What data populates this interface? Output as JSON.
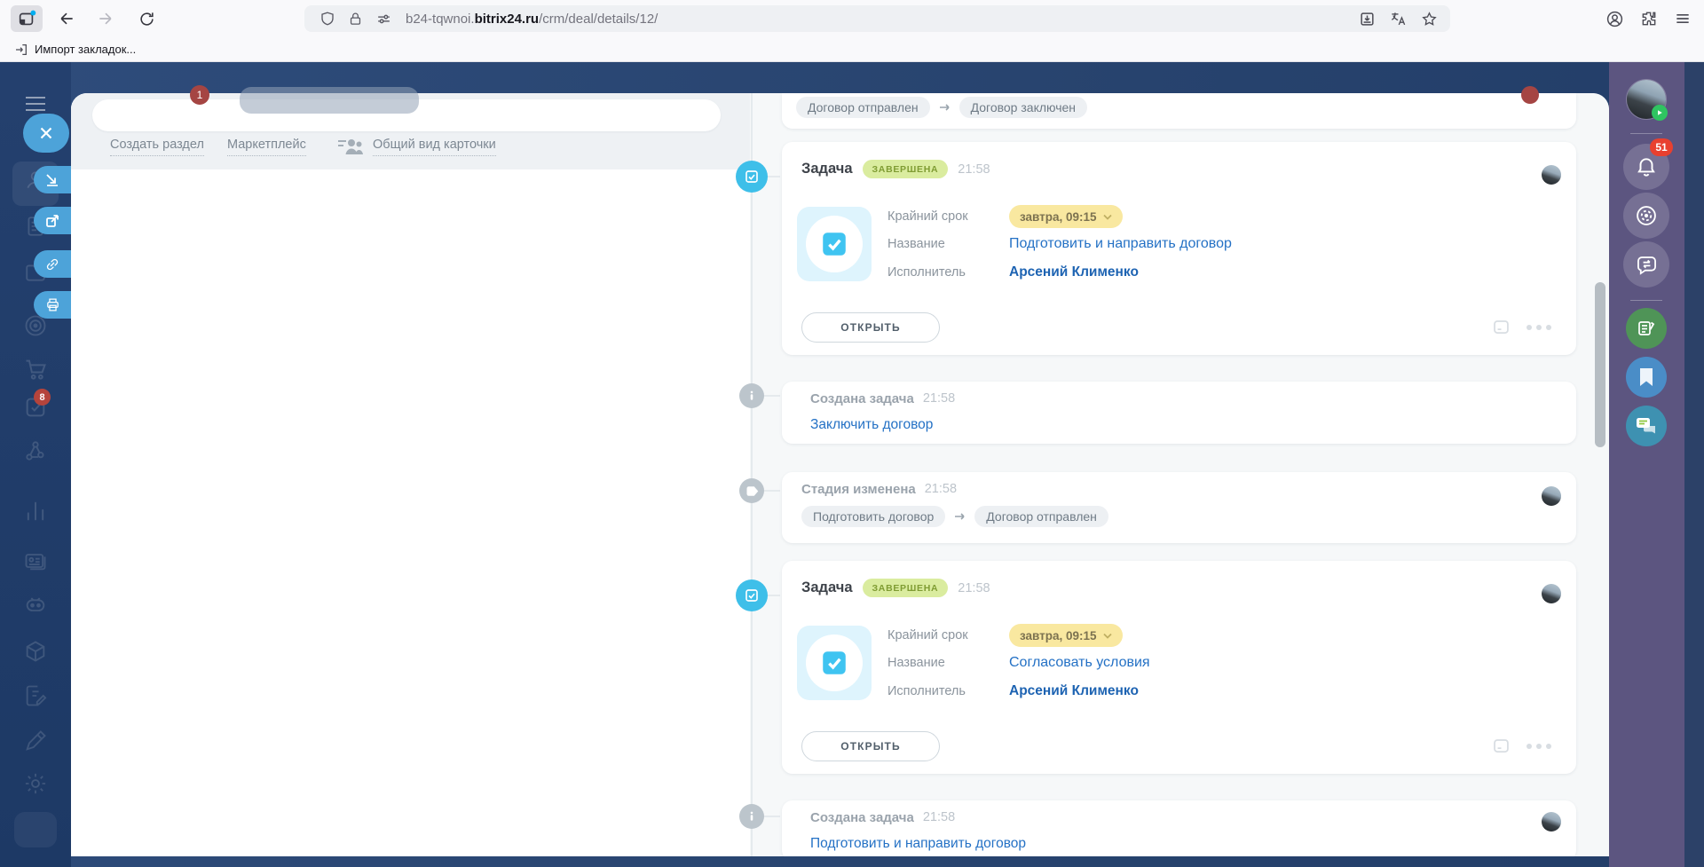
{
  "colors": {
    "navy_bg": "#24416e",
    "accent_blue": "#2471c5",
    "task_icon_blue": "#3ebfe9",
    "status_green_bg": "#daec9f",
    "status_green_text": "#7f9c33",
    "deadline_pill_bg": "#f9e8a0",
    "notification_red": "#e8402f"
  },
  "browser": {
    "url_prefix": "b24-tqwnoi.",
    "url_domain": "bitrix24.ru",
    "url_path": "/crm/deal/details/12/",
    "bookmarks_bar_item": "Импорт закладок..."
  },
  "header_badges": {
    "left_count": "1"
  },
  "left_panel": {
    "link_create_section": "Создать раздел",
    "link_marketplace": "Маркетплейс",
    "link_card_view": "Общий вид карточки"
  },
  "left_rail": {
    "tasks_badge": "8"
  },
  "right_rail": {
    "notifications_badge": "51"
  },
  "timeline": {
    "items": [
      {
        "type": "stage",
        "from": "Договор отправлен",
        "to": "Договор заключен"
      },
      {
        "type": "task",
        "title": "Задача",
        "status": "ЗАВЕРШЕНА",
        "time": "21:58",
        "deadline_label": "Крайний срок",
        "deadline_value": "завтра, 09:15",
        "name_label": "Название",
        "name_value": "Подготовить и направить договор",
        "assignee_label": "Исполнитель",
        "assignee_value": "Арсений Клименко",
        "open_button": "ОТКРЫТЬ"
      },
      {
        "type": "info",
        "title": "Создана задача",
        "time": "21:58",
        "link": "Заключить договор"
      },
      {
        "type": "stage",
        "title": "Стадия изменена",
        "time": "21:58",
        "from": "Подготовить договор",
        "to": "Договор отправлен"
      },
      {
        "type": "task",
        "title": "Задача",
        "status": "ЗАВЕРШЕНА",
        "time": "21:58",
        "deadline_label": "Крайний срок",
        "deadline_value": "завтра, 09:15",
        "name_label": "Название",
        "name_value": "Согласовать условия",
        "assignee_label": "Исполнитель",
        "assignee_value": "Арсений Клименко",
        "open_button": "ОТКРЫТЬ"
      },
      {
        "type": "info",
        "title": "Создана задача",
        "time": "21:58",
        "link": "Подготовить и направить договор"
      }
    ]
  }
}
